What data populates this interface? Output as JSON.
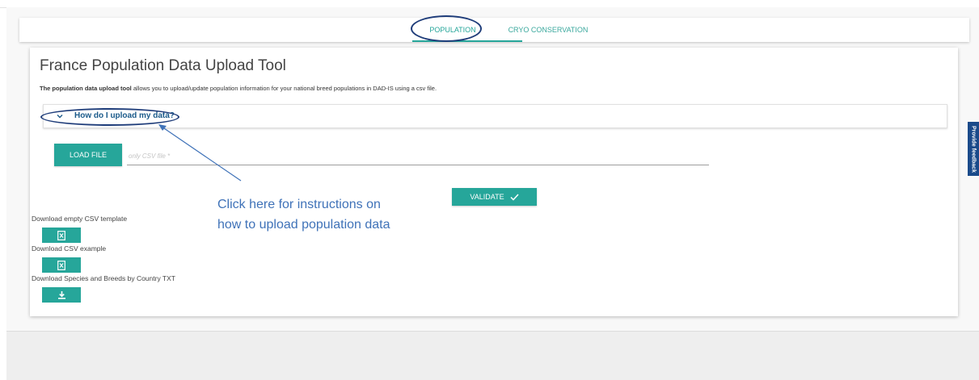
{
  "tabs": [
    {
      "label": "POPULATION",
      "active": true
    },
    {
      "label": "CRYO CONSERVATION",
      "active": false
    }
  ],
  "page": {
    "title": "France Population Data Upload Tool",
    "description_bold": "The population data upload tool",
    "description_rest": " allows you to upload/update population information for your national breed populations in DAD-IS using a csv file."
  },
  "accordion": {
    "label": "How do I upload my data?",
    "icon": "chevron-down-icon"
  },
  "upload": {
    "load_label": "LOAD FILE",
    "file_placeholder": "only CSV file *",
    "validate_label": "VALIDATE",
    "validate_icon": "check-icon"
  },
  "downloads": [
    {
      "label": "Download empty CSV template",
      "icon": "excel-file-icon"
    },
    {
      "label": "Download CSV example",
      "icon": "excel-file-icon"
    },
    {
      "label": "Download Species and Breeds by Country TXT",
      "icon": "download-icon"
    }
  ],
  "annotation": {
    "line1": "Click here for instructions on",
    "line2": "how to upload population data"
  },
  "feedback_label": "Provide feedback",
  "colors": {
    "accent": "#26a69a",
    "annotation_blue": "#3f72b8",
    "ellipse_navy": "#1f3d7a",
    "feedback_bg": "#1a4a8a"
  }
}
